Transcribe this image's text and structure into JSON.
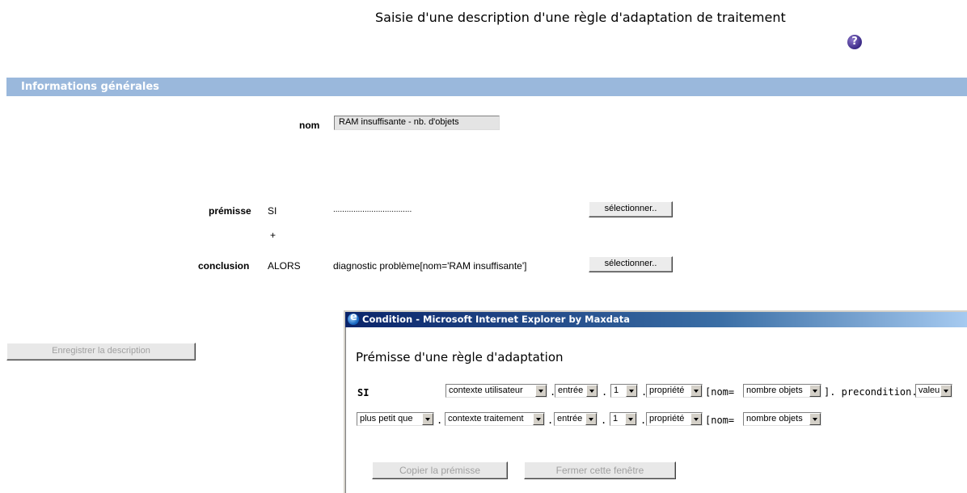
{
  "page": {
    "title": "Saisie d'une description d'une règle d'adaptation de traitement",
    "help_icon": "question-circle-icon"
  },
  "section": {
    "title": "Informations générales"
  },
  "form": {
    "nom_label": "nom",
    "nom_value": "RAM insuffisante - nb. d'objets",
    "premisse_label": "prémisse",
    "premisse_keyword": "SI",
    "premisse_value": "...................................",
    "plus": "+",
    "conclusion_label": "conclusion",
    "conclusion_keyword": "ALORS",
    "conclusion_value": "diagnostic problème[nom='RAM insuffisante']",
    "select_button": "sélectionner..",
    "save_button": "Enregistrer la description"
  },
  "popup": {
    "window_title": "Condition - Microsoft Internet Explorer by Maxdata",
    "heading": "Prémisse d'une règle d'adaptation",
    "si": "SI",
    "row1": {
      "sel1": "contexte utilisateur",
      "sel2": "entrée",
      "sel3": "1",
      "sel4": "propriété",
      "nom_prefix": "[nom=",
      "sel5": "nombre objets",
      "suffix": "]. precondition.",
      "sel6": "valeur"
    },
    "row2": {
      "sel1": "plus petit que",
      "sel2": "contexte traitement",
      "sel3": "entrée",
      "sel4": "1",
      "sel5": "propriété",
      "nom_prefix": "[nom=",
      "sel6": "nombre objets"
    },
    "dot": ".",
    "copy_button": "Copier la prémisse",
    "close_button": "Fermer cette fenêtre"
  }
}
